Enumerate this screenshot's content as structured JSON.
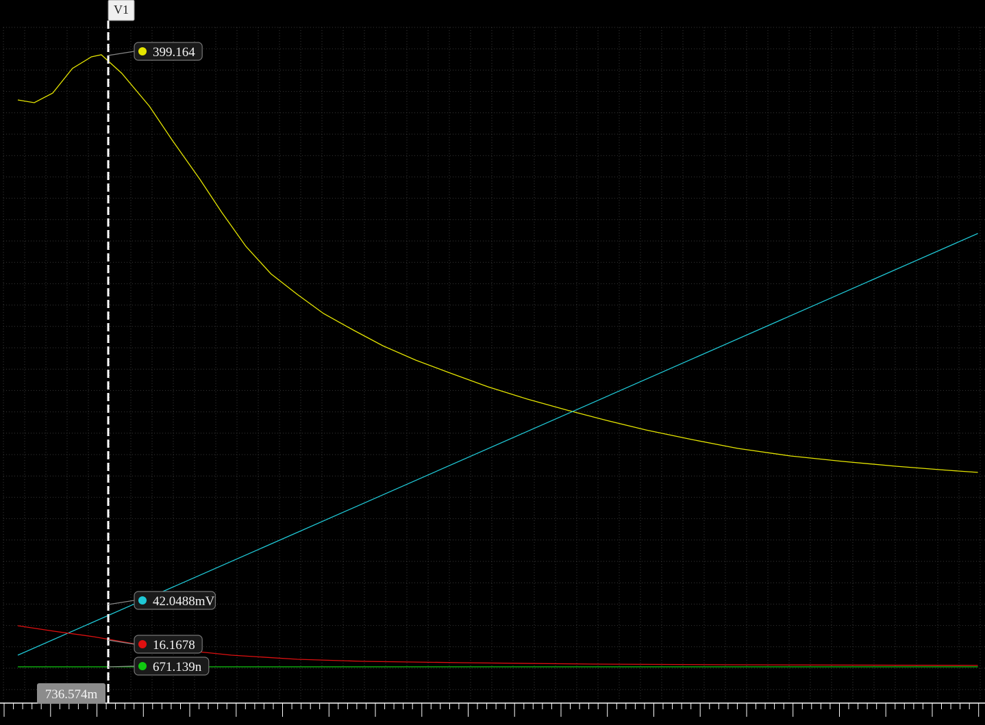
{
  "chart_data": {
    "type": "line",
    "title": "",
    "xlabel": "",
    "ylabel": "",
    "grid": true,
    "background": "#000000",
    "grid_color": "#3a3a3a",
    "series": [
      {
        "color": "#e6e600",
        "points": [
          [
            0.25,
            146
          ],
          [
            0.5,
            150
          ],
          [
            0.78,
            136
          ],
          [
            1.08,
            100
          ],
          [
            1.37,
            83
          ],
          [
            1.52,
            80
          ],
          [
            1.83,
            107
          ],
          [
            2.25,
            155
          ],
          [
            2.6,
            205
          ],
          [
            3.02,
            262
          ],
          [
            3.35,
            310
          ],
          [
            3.72,
            360
          ],
          [
            4.1,
            400
          ],
          [
            4.5,
            430
          ],
          [
            4.9,
            458
          ],
          [
            5.35,
            482
          ],
          [
            5.8,
            505
          ],
          [
            6.3,
            526
          ],
          [
            6.8,
            544
          ],
          [
            7.4,
            565
          ],
          [
            8.0,
            583
          ],
          [
            8.6,
            599
          ],
          [
            9.2,
            614
          ],
          [
            9.8,
            628
          ],
          [
            10.5,
            642
          ],
          [
            11.2,
            655
          ],
          [
            12.0,
            666
          ],
          [
            12.8,
            674
          ],
          [
            13.6,
            681
          ],
          [
            14.4,
            687
          ],
          [
            14.85,
            690
          ]
        ]
      },
      {
        "color": "#1fc8d6",
        "points": [
          [
            0.25,
            957
          ],
          [
            14.85,
            341
          ]
        ]
      },
      {
        "color": "#e01010",
        "points": [
          [
            0.25,
            914
          ],
          [
            0.8,
            922
          ],
          [
            1.4,
            930
          ],
          [
            2.0,
            940
          ],
          [
            2.8,
            950
          ],
          [
            3.5,
            957
          ],
          [
            4.5,
            963
          ],
          [
            5.5,
            966
          ],
          [
            7.0,
            968
          ],
          [
            9.0,
            970
          ],
          [
            11.0,
            971
          ],
          [
            14.85,
            972
          ]
        ]
      },
      {
        "color": "#10c810",
        "points": [
          [
            0.25,
            974
          ],
          [
            14.85,
            974
          ]
        ]
      }
    ],
    "cursor": {
      "label": "V1",
      "x": 1.624,
      "x_label": "736.574m",
      "readouts": [
        {
          "value": "399.164",
          "color": "#e6e600",
          "level": 81
        },
        {
          "value": "42.0488mV",
          "color": "#1fc8d6",
          "level": 883
        },
        {
          "value": "16.1678",
          "color": "#e01010",
          "level": 935
        },
        {
          "value": "671.139n",
          "color": "#10c810",
          "level": 974
        }
      ]
    }
  }
}
